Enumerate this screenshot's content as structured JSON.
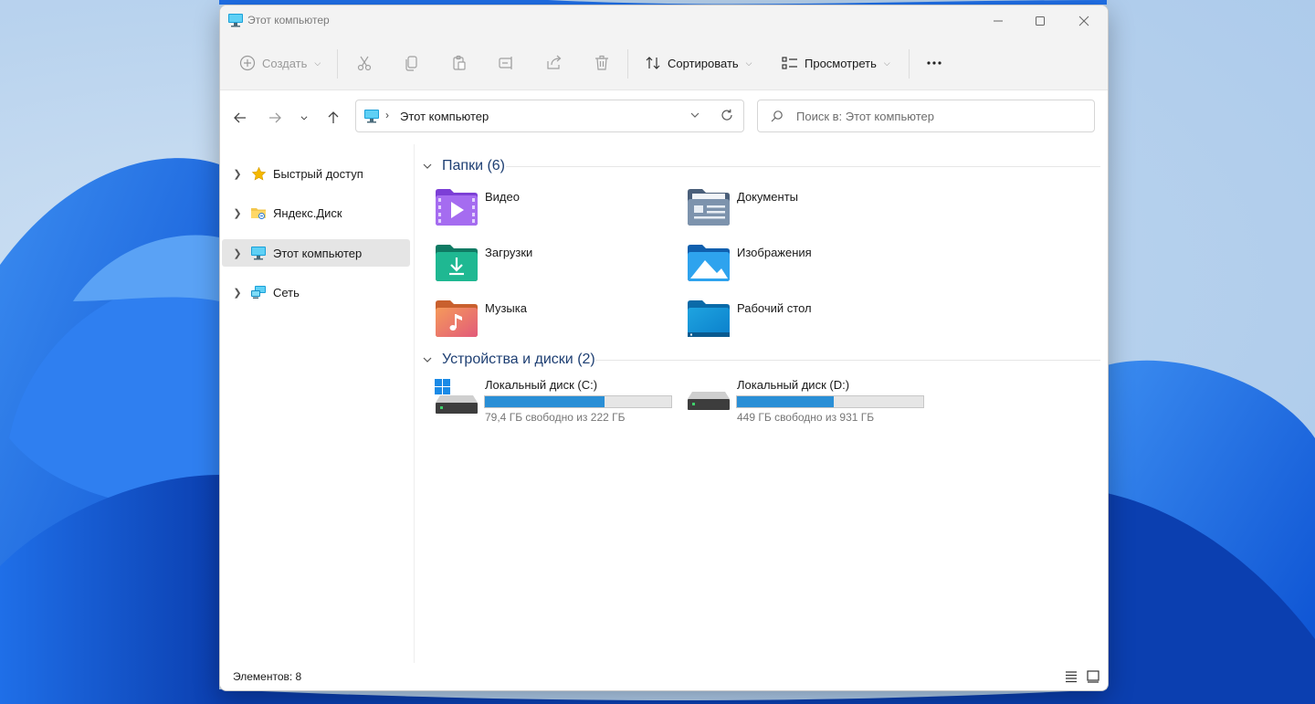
{
  "window": {
    "title": "Этот компьютер",
    "controls": [
      "minimize-icon",
      "maximize-icon",
      "close-icon"
    ]
  },
  "commandbar": {
    "create_label": "Создать",
    "sort_label": "Сортировать",
    "view_label": "Просмотреть",
    "icons": [
      "add-icon",
      "cut-icon",
      "copy-icon",
      "paste-icon",
      "rename-icon",
      "share-icon",
      "delete-icon",
      "sort-icon",
      "view-icon",
      "more-icon"
    ]
  },
  "nav": {
    "address_path": "Этот компьютер",
    "address_separator": "›",
    "search_placeholder": "Поиск в: Этот компьютер"
  },
  "sidebar": {
    "items": [
      {
        "label": "Быстрый доступ",
        "icon": "star-icon",
        "selected": false
      },
      {
        "label": "Яндекс.Диск",
        "icon": "yandex-disk-icon",
        "selected": false
      },
      {
        "label": "Этот компьютер",
        "icon": "computer-icon",
        "selected": true
      },
      {
        "label": "Сеть",
        "icon": "network-icon",
        "selected": false
      }
    ]
  },
  "content": {
    "folders_header": "Папки (6)",
    "folders": [
      {
        "name": "Видео",
        "icon": "video-folder-icon"
      },
      {
        "name": "Документы",
        "icon": "documents-folder-icon"
      },
      {
        "name": "Загрузки",
        "icon": "downloads-folder-icon"
      },
      {
        "name": "Изображения",
        "icon": "pictures-folder-icon"
      },
      {
        "name": "Музыка",
        "icon": "music-folder-icon"
      },
      {
        "name": "Рабочий стол",
        "icon": "desktop-folder-icon"
      }
    ],
    "drives_header": "Устройства и диски (2)",
    "drives": [
      {
        "name": "Локальный диск (C:)",
        "free_text": "79,4 ГБ свободно из 222 ГБ",
        "used_fraction": 0.642,
        "icon": "system-drive-icon"
      },
      {
        "name": "Локальный диск (D:)",
        "free_text": "449 ГБ свободно из 931 ГБ",
        "used_fraction": 0.518,
        "icon": "drive-icon"
      }
    ]
  },
  "status": {
    "items_text": "Элементов: 8"
  },
  "colors": {
    "accent": "#2a8fd6",
    "group_header": "#1e3f73",
    "selected_bg": "#e5e5e5"
  }
}
